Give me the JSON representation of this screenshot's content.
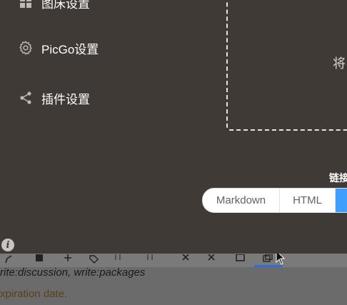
{
  "sidebar": {
    "items": [
      {
        "label": "图床设置",
        "icon": "grid-icon"
      },
      {
        "label": "PicGo设置",
        "icon": "gear-icon"
      },
      {
        "label": "插件设置",
        "icon": "share-icon"
      }
    ]
  },
  "upload": {
    "drop_text": "将"
  },
  "link_format": {
    "label": "链接",
    "options": [
      "Markdown",
      "HTML"
    ],
    "active_index": 2
  },
  "background_page": {
    "scopes_text": "rite:discussion, write:packages",
    "expiration_text": "xpiration date."
  },
  "colors": {
    "app_bg": "#3f3a36",
    "accent": "#409eff",
    "bg_page": "#6b6b6b"
  }
}
